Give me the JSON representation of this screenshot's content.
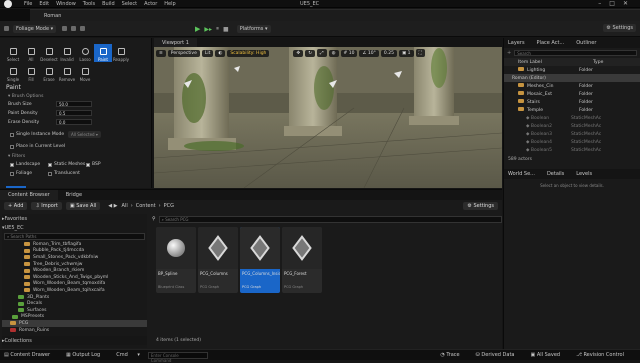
{
  "app": {
    "title": "UE5_EC",
    "menu": [
      "File",
      "Edit",
      "Window",
      "Tools",
      "Build",
      "Select",
      "Actor",
      "Help"
    ],
    "tab": "Roman"
  },
  "toolbar": {
    "mode": "Foliage Mode",
    "platforms": "Platforms",
    "settings": "Settings"
  },
  "foliage": {
    "tools": [
      "Select",
      "All",
      "Deselect",
      "Invalid",
      "Lasso",
      "Paint",
      "Reapply",
      "Single",
      "Fill",
      "Erase",
      "Remove",
      "Move"
    ],
    "paint_title": "Paint",
    "brush_options": "Brush Options",
    "brush_size_label": "Brush Size",
    "brush_size": "50.0",
    "paint_density_label": "Paint Density",
    "paint_density": "0.5",
    "erase_density_label": "Erase Density",
    "erase_density": "0.0",
    "single_instance_label": "Single Instance Mode",
    "single_instance_value": "All Selected",
    "place_current_level": "Place in Current Level",
    "filters": "Filters",
    "filter_landscape": "Landscape",
    "filter_static_meshes": "Static Meshes",
    "filter_bsp": "BSP",
    "filter_foliage": "Foliage",
    "filter_translucent": "Translucent"
  },
  "viewport": {
    "tab": "Viewport 1",
    "perspective": "Perspective",
    "lit": "Lit",
    "scalability": "Scalability: High",
    "grid": "10",
    "angle": "10°",
    "scale": "0.25",
    "speed": "1"
  },
  "outliner": {
    "tabs": [
      "Layers",
      "Place Act...",
      "Outliner"
    ],
    "search_placeholder": "Search",
    "col_label": "Item Label",
    "col_type": "Type",
    "rows": [
      {
        "label": "Lighting",
        "type": "Folder",
        "dim": false
      },
      {
        "label": "Roman (Editor)",
        "type": "",
        "dim": false
      },
      {
        "label": "Meshes_Cin",
        "type": "Folder",
        "dim": false
      },
      {
        "label": "Mosaic_Ext",
        "type": "Folder",
        "dim": false
      },
      {
        "label": "Stairs",
        "type": "Folder",
        "dim": false
      },
      {
        "label": "Temple",
        "type": "Folder",
        "dim": false
      },
      {
        "label": "Boolean",
        "type": "StaticMeshAc",
        "dim": true
      },
      {
        "label": "Boolean2",
        "type": "StaticMeshAc",
        "dim": true
      },
      {
        "label": "Boolean3",
        "type": "StaticMeshAc",
        "dim": true
      },
      {
        "label": "Boolean4",
        "type": "StaticMeshAc",
        "dim": true
      },
      {
        "label": "Boolean5",
        "type": "StaticMeshAc",
        "dim": true
      }
    ],
    "count": "589 actors"
  },
  "details": {
    "tabs": [
      "World Se...",
      "Details",
      "Levels"
    ],
    "empty_text": "Select an object to view details."
  },
  "content_browser": {
    "tabs": [
      "Content Browser",
      "Bridge"
    ],
    "add": "Add",
    "import": "Import",
    "save_all": "Save All",
    "path": [
      "All",
      "Content",
      "PCG"
    ],
    "settings": "Settings",
    "favorites": "Favorites",
    "project": "UE5_EC",
    "search_paths": "Search Paths",
    "folders": [
      "Roman_Trim_tbflagifa",
      "Rubble_Pack_tj4mccda",
      "Small_Stones_Pack_vdkbfniw",
      "Tree_Debris_vchwmjw",
      "Wooden_Branch_rkiem",
      "Wooden_Sticks_And_Twigs_pbyml",
      "Worn_Wooden_Beam_tqmoxdifa",
      "Worn_Wooden_Beam_tqihxcaifa",
      "3D_Plants",
      "Decals",
      "Surfaces",
      "MSPresets",
      "PCG",
      "Roman_Ruins"
    ],
    "search_placeholder": "Search PCG",
    "assets": [
      {
        "name": "BP_Spline",
        "type": "Blueprint Class"
      },
      {
        "name": "PCG_Columns",
        "type": "PCG Graph"
      },
      {
        "name": "PCG_Columns_Inside",
        "type": "PCG Graph"
      },
      {
        "name": "PCG_Forest",
        "type": "PCG Graph"
      }
    ],
    "status": "4 items (1 selected)",
    "collections": "Collections"
  },
  "statusbar": {
    "content_drawer": "Content Drawer",
    "output_log": "Output Log",
    "cmd": "Cmd",
    "cmd_placeholder": "Enter Console Command",
    "trace": "Trace",
    "derived_data": "Derived Data",
    "all_saved": "All Saved",
    "revision_control": "Revision Control"
  }
}
